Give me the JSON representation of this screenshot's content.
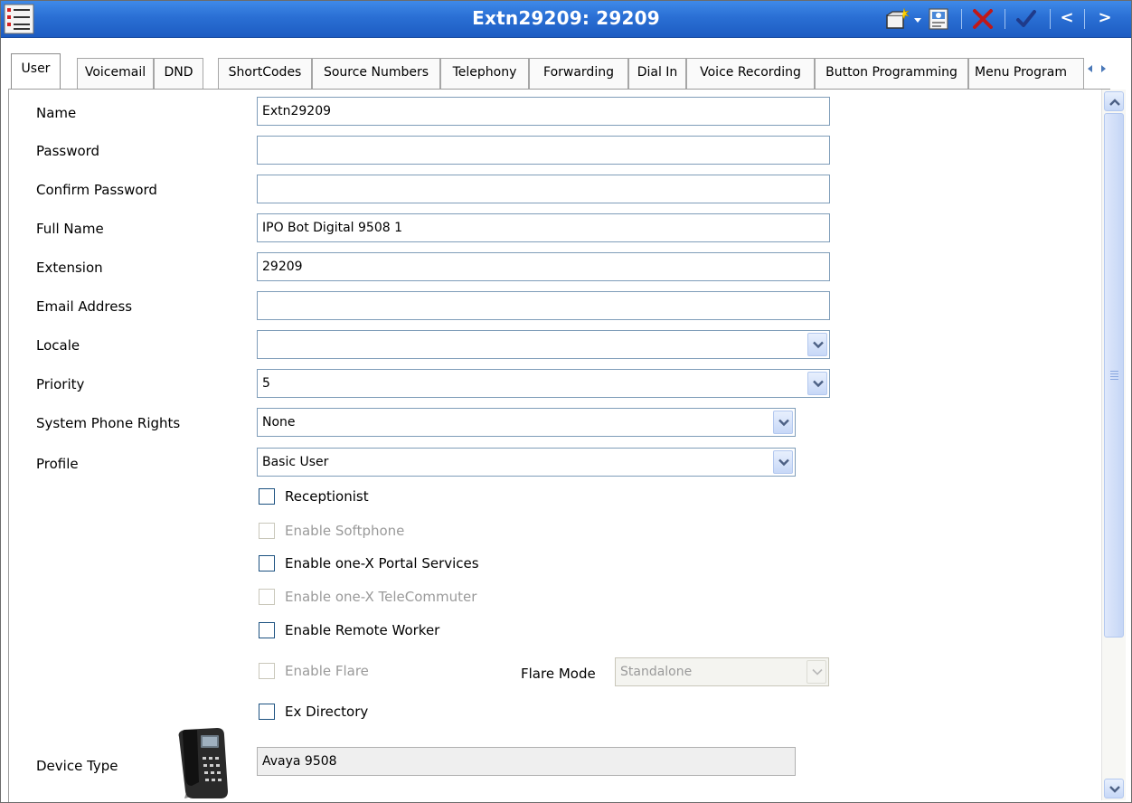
{
  "window": {
    "title": "Extn29209: 29209",
    "icons": [
      "list-icon",
      "new-record-icon",
      "dropdown-arrow-icon",
      "export-icon",
      "cancel-x-icon",
      "ok-check-icon"
    ],
    "nav_prev": "<",
    "nav_next": ">"
  },
  "tabs": [
    {
      "label": "User",
      "active": true
    },
    {
      "label": "Voicemail"
    },
    {
      "label": "DND"
    },
    {
      "label": "ShortCodes"
    },
    {
      "label": "Source Numbers"
    },
    {
      "label": "Telephony"
    },
    {
      "label": "Forwarding"
    },
    {
      "label": "Dial In"
    },
    {
      "label": "Voice Recording"
    },
    {
      "label": "Button Programming"
    },
    {
      "label": "Menu Program"
    }
  ],
  "form": {
    "name": {
      "label": "Name",
      "value": "Extn29209"
    },
    "password": {
      "label": "Password",
      "value": ""
    },
    "confirm_password": {
      "label": "Confirm Password",
      "value": ""
    },
    "full_name": {
      "label": "Full Name",
      "value": "IPO Bot Digital 9508 1"
    },
    "extension": {
      "label": "Extension",
      "value": "29209"
    },
    "email": {
      "label": "Email Address",
      "value": ""
    },
    "locale": {
      "label": "Locale",
      "value": ""
    },
    "priority": {
      "label": "Priority",
      "value": "5"
    },
    "system_phone_rights": {
      "label": "System Phone Rights",
      "value": "None"
    },
    "profile": {
      "label": "Profile",
      "value": "Basic User"
    },
    "checkboxes": {
      "receptionist": {
        "label": "Receptionist",
        "checked": false,
        "enabled": true
      },
      "softphone": {
        "label": "Enable Softphone",
        "checked": false,
        "enabled": false
      },
      "portal": {
        "label": "Enable one-X Portal Services",
        "checked": false,
        "enabled": true
      },
      "telecommuter": {
        "label": "Enable one-X TeleCommuter",
        "checked": false,
        "enabled": false
      },
      "remote_worker": {
        "label": "Enable Remote Worker",
        "checked": false,
        "enabled": true
      },
      "flare": {
        "label": "Enable Flare",
        "checked": false,
        "enabled": false
      },
      "ex_directory": {
        "label": "Ex Directory",
        "checked": false,
        "enabled": true
      }
    },
    "flare_mode": {
      "label": "Flare Mode",
      "value": "Standalone",
      "enabled": false
    },
    "device_type": {
      "label": "Device Type",
      "value": "Avaya 9508",
      "icon": "desk-phone-icon"
    }
  },
  "colors": {
    "titlebar": "#2a6fd4",
    "cancel": "#c01818",
    "ok": "#1f3a8a",
    "field_border": "#7f9db9"
  }
}
